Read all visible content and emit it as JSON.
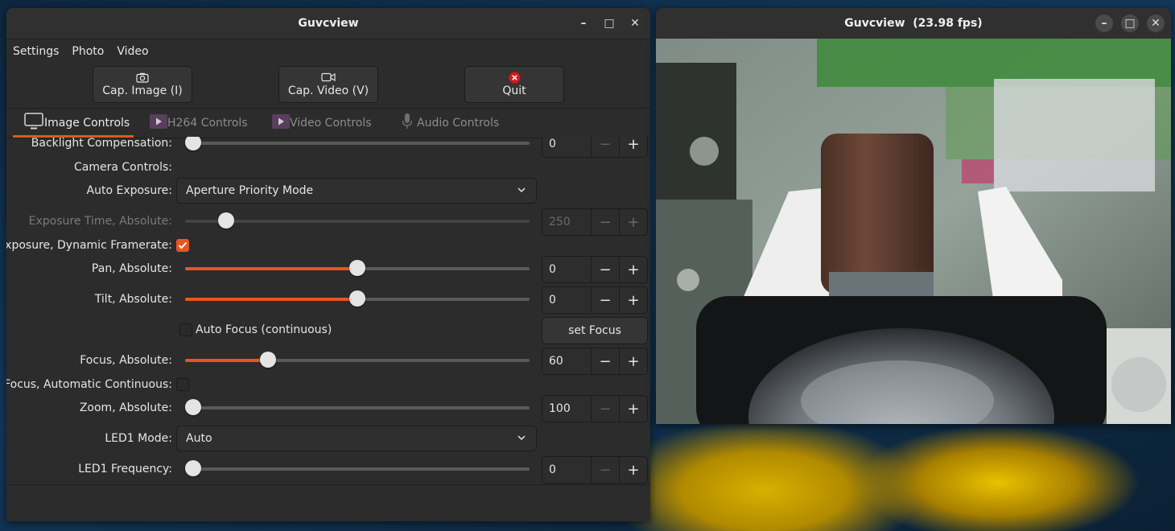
{
  "main_window": {
    "title": "Guvcview",
    "controls": {
      "minimize": "–",
      "maximize": "□",
      "close": "✕"
    },
    "menu": [
      "Settings",
      "Photo",
      "Video"
    ],
    "toolbar": {
      "cap_image": "Cap. Image (I)",
      "cap_video": "Cap. Video (V)",
      "quit": "Quit"
    },
    "tabs": [
      "Image Controls",
      "H264 Controls",
      "Video Controls",
      "Audio Controls"
    ],
    "active_tab": "Image Controls"
  },
  "controls": {
    "backlight": {
      "label": "Backlight Compensation:",
      "value": "0",
      "level": 0
    },
    "camera_controls_label": "Camera Controls:",
    "auto_exposure": {
      "label": "Auto Exposure:",
      "selected": "Aperture Priority Mode"
    },
    "exposure_time": {
      "label": "Exposure Time, Absolute:",
      "value": "250",
      "level": 0.12,
      "disabled": true
    },
    "dynamic_framerate": {
      "label": "Exposure, Dynamic Framerate:",
      "checked": true
    },
    "pan": {
      "label": "Pan, Absolute:",
      "value": "0",
      "level": 0.5
    },
    "tilt": {
      "label": "Tilt, Absolute:",
      "value": "0",
      "level": 0.5
    },
    "auto_focus": {
      "label": "Auto Focus (continuous)",
      "checked": false
    },
    "set_focus": "set Focus",
    "focus": {
      "label": "Focus, Absolute:",
      "value": "60",
      "level": 0.24
    },
    "focus_auto_continuous": {
      "label": "Focus, Automatic Continuous:",
      "checked": false
    },
    "zoom": {
      "label": "Zoom, Absolute:",
      "value": "100",
      "level": 0
    },
    "led1_mode": {
      "label": "LED1 Mode:",
      "selected": "Auto"
    },
    "led1_frequency": {
      "label": "LED1 Frequency:",
      "value": "0",
      "level": 0
    }
  },
  "spin_symbols": {
    "minus": "−",
    "plus": "+"
  },
  "preview_window": {
    "title": "Guvcview  (23.98 fps)"
  },
  "colors": {
    "accent": "#e95420",
    "window_bg": "#2c2c2c",
    "titlebar_bg": "#303030",
    "quit_icon": "#d7191c"
  }
}
